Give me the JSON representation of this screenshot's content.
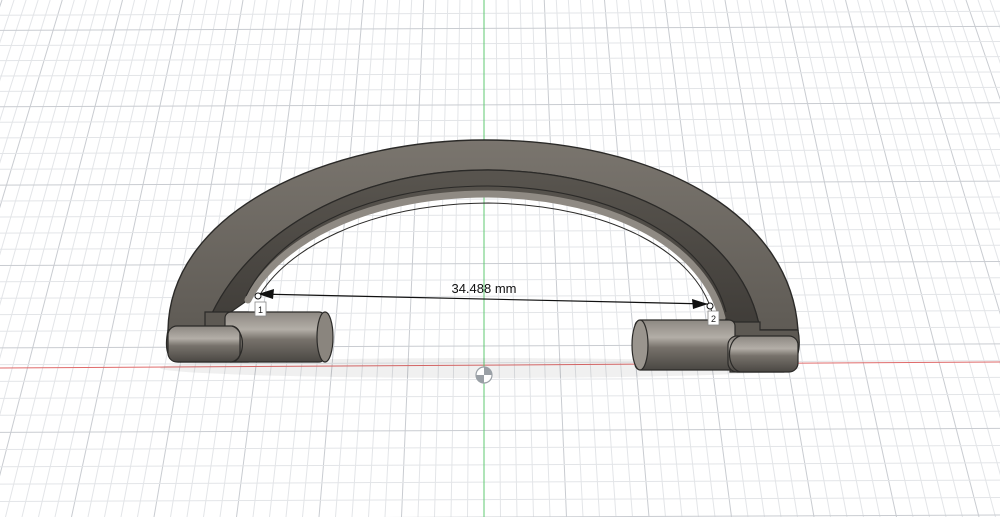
{
  "viewport": {
    "measurement": {
      "value_label": "34.488 mm",
      "point_1_label": "1",
      "point_2_label": "2"
    },
    "colors": {
      "background": "#ffffff",
      "grid_minor": "#e3e5e8",
      "grid_major": "#c9ccd1",
      "x_axis": "#e06b6b",
      "y_axis": "#5fca72",
      "body_fill": "#6f6a63",
      "body_edge": "#2b2a28"
    }
  }
}
